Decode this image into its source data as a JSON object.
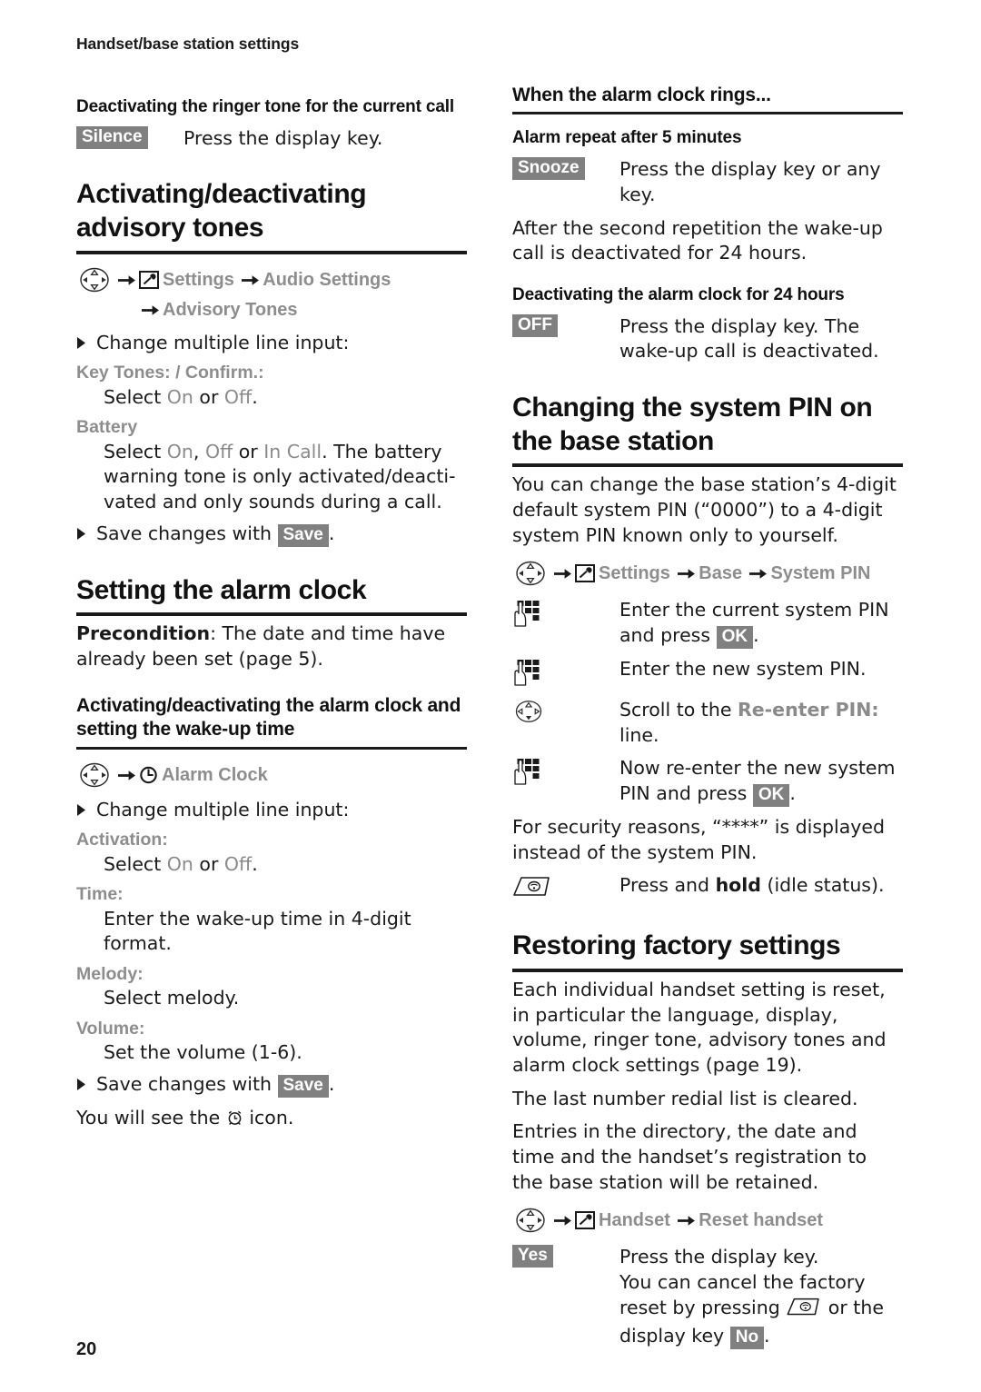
{
  "running_head": "Handset/base station settings",
  "page_number": "20",
  "colors": {
    "badge_bg": "#808080",
    "ui_text": "#8d8d8d",
    "body_text": "#1a1a1a",
    "rule": "#1a1a1a"
  },
  "left_column": {
    "ringer_section": {
      "heading": "Deactivating the ringer tone for the current call",
      "key_label": "Silence",
      "key_desc": "Press the display key."
    },
    "advisory_section": {
      "heading": "Activating/deactivating advisory tones",
      "path": {
        "menu1": "Settings",
        "menu2": "Audio Settings",
        "menu3": "Advisory Tones"
      },
      "bullet_change": "Change multiple line input:",
      "params": [
        {
          "term": "Key Tones: / Confirm.:",
          "desc_pre": "Select ",
          "opt1": "On",
          "desc_mid": " or ",
          "opt2": "Off",
          "desc_post": "."
        },
        {
          "term": "Battery",
          "desc_pre": "Select ",
          "opt1": "On",
          "desc_mid": ", ",
          "opt2": "Off",
          "desc_mid2": " or ",
          "opt3": "In Call",
          "desc_post": ". The battery warning tone is only activated/deacti-vated and only sounds during a call."
        }
      ],
      "bullet_save_pre": "Save changes with ",
      "bullet_save_key": "Save",
      "bullet_save_post": "."
    },
    "alarm_section": {
      "heading": "Setting the alarm clock",
      "precondition_label": "Precondition",
      "precondition_text": ": The date and time have already been set (page 5).",
      "sub_heading": "Activating/deactivating the alarm clock and setting the wake-up time",
      "path_menu": "Alarm Clock",
      "bullet_change": "Change multiple line input:",
      "params": [
        {
          "term": "Activation:",
          "desc_pre": "Select ",
          "opt1": "On",
          "desc_mid": " or ",
          "opt2": "Off",
          "desc_post": "."
        },
        {
          "term": "Time:",
          "desc_pre": "Enter the wake-up time in 4-digit format.",
          "opt1": "",
          "desc_mid": "",
          "opt2": "",
          "desc_post": ""
        },
        {
          "term": "Melody:",
          "desc_pre": "Select melody.",
          "opt1": "",
          "desc_mid": "",
          "opt2": "",
          "desc_post": ""
        },
        {
          "term": "Volume:",
          "desc_pre": "Set the volume (1-6).",
          "opt1": "",
          "desc_mid": "",
          "opt2": "",
          "desc_post": ""
        }
      ],
      "bullet_save_pre": "Save changes with ",
      "bullet_save_key": "Save",
      "bullet_save_post": ".",
      "icon_note_pre": "You will see the ",
      "icon_note_post": " icon."
    }
  },
  "right_column": {
    "rings_section": {
      "heading": "When the alarm clock rings...",
      "repeat_heading": "Alarm repeat after 5 minutes",
      "snooze_key": "Snooze",
      "snooze_desc": "Press the display key or any key.",
      "after_text": "After the second repetition the wake-up call is deactivated for 24 hours.",
      "deactivate_heading": "Deactivating the alarm clock for 24 hours",
      "off_key": "OFF",
      "off_desc": "Press the display key. The wake-up call is deactivated."
    },
    "pin_section": {
      "heading": "Changing the system PIN on the base station",
      "intro": "You can change the base station’s 4-digit default system PIN (“0000”) to a 4-digit system PIN known only to yourself.",
      "path": {
        "menu1": "Settings",
        "menu2": "Base",
        "menu3": "System PIN"
      },
      "steps": [
        {
          "icon": "keypad-icon",
          "pre": "Enter the current system PIN and press ",
          "key": "OK",
          "post": "."
        },
        {
          "icon": "keypad-icon",
          "pre": "Enter the new system PIN.",
          "key": "",
          "post": ""
        },
        {
          "icon": "nav-key-icon",
          "pre": "Scroll to the ",
          "ui": "Re-enter PIN:",
          "post": " line."
        },
        {
          "icon": "keypad-icon",
          "pre": "Now re-enter the new system PIN and press ",
          "key": "OK",
          "post": "."
        }
      ],
      "security_note": "For security reasons, “****” is displayed instead of the system PIN.",
      "hold_pre": "Press and ",
      "hold_bold": "hold",
      "hold_post": " (idle status)."
    },
    "reset_section": {
      "heading": "Restoring factory settings",
      "p1": "Each individual handset setting is reset, in particular the language, display, volume, ringer tone, advisory tones and alarm clock settings (page 19).",
      "p2": "The last number redial list is cleared.",
      "p3": "Entries in the directory, the date and time and the handset’s registration to the base station will be retained.",
      "path": {
        "menu1": "Handset",
        "menu2": "Reset handset"
      },
      "yes_key": "Yes",
      "yes_desc_1": "Press the display key.",
      "yes_desc_2_pre": "You can cancel the factory reset by pressing ",
      "yes_desc_2_mid": " or the display key ",
      "yes_desc_2_key": "No",
      "yes_desc_2_post": "."
    }
  }
}
